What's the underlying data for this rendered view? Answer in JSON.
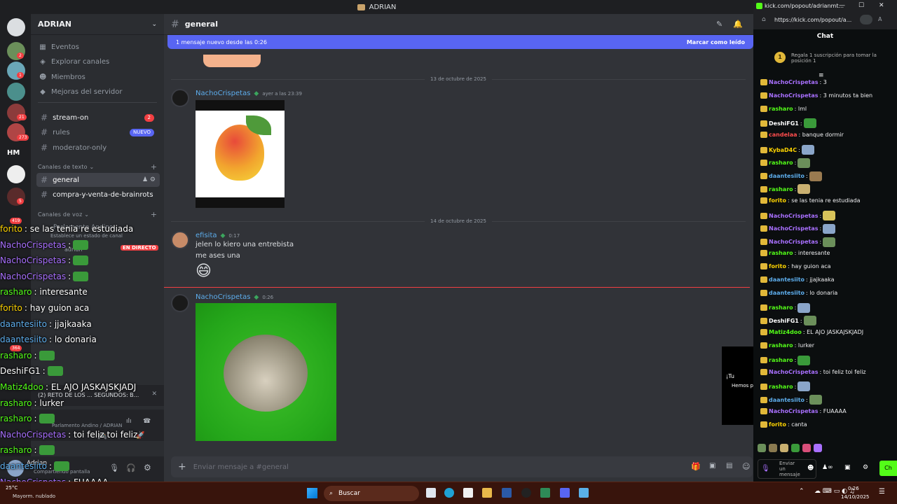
{
  "window": {
    "title": "ADRIAN"
  },
  "server": {
    "name": "ADRIAN"
  },
  "sidebar": {
    "menu": [
      {
        "label": "Eventos",
        "icon": "calendar-icon"
      },
      {
        "label": "Explorar canales",
        "icon": "compass-icon"
      },
      {
        "label": "Miembros",
        "icon": "members-icon"
      },
      {
        "label": "Mejoras del servidor",
        "icon": "boost-icon"
      }
    ],
    "top_channels": [
      {
        "name": "stream-on",
        "badge": "2"
      },
      {
        "name": "rules",
        "badge": "NUEVO"
      },
      {
        "name": "moderator-only",
        "badge": ""
      }
    ],
    "text_category": "Canales de texto",
    "text_channels": [
      {
        "name": "general"
      },
      {
        "name": "compra-y-venta-de-brainrots"
      }
    ],
    "voice_category": "Canales de voz",
    "voice_channel": "Parlamento Andino",
    "voice_status": "Establece un estado de canal",
    "live_badge": "EN DIRECTO",
    "voice_user": "adrian",
    "voice_connected": "Parlamento Andino / ADRIAN",
    "reto": "(2) RETO DE LOS ... SEGUNDOS: B...",
    "server_badges": [
      "2",
      "1",
      "21",
      "273",
      "HM",
      "5",
      "419",
      "364"
    ]
  },
  "user": {
    "name": "Adrian",
    "status": "Compartiendo pantalla"
  },
  "channel": {
    "name": "general",
    "new_banner": "1 mensaje nuevo desde las 0:26",
    "mark_read": "Marcar como leído",
    "composer_placeholder": "Enviar mensaje a #general"
  },
  "messages": [
    {
      "date": "13 de octubre de 2025"
    },
    {
      "author": "NachoCrispetas",
      "time": "ayer a las 23:39"
    },
    {
      "date": "14 de octubre de 2025"
    },
    {
      "author": "efisita",
      "time": "0:17",
      "lines": [
        "jelen lo kiero una entrebista",
        "me ases una"
      ],
      "emoji": "😄"
    },
    {
      "author": "NachoCrispetas",
      "time": "0:26"
    }
  ],
  "partial_popup": {
    "line1": "¡Tu",
    "line2": "Hemos p"
  },
  "kick": {
    "url_title": "kick.com/popout/adrianmt...",
    "url": "https://kick.com/popout/a...",
    "header": "Chat",
    "sub_rank": "1",
    "sub_promo": "Regala 1 suscripción para tomar la posición 1",
    "input_placeholder": "Enviar un mensaje",
    "send_label": "Ch",
    "messages": [
      {
        "user": "NachoCrispetas",
        "color": "#a970ff",
        "text": ": 3"
      },
      {
        "user": "NachoCrispetas",
        "color": "#a970ff",
        "text": ": 3 minutos ta bien"
      },
      {
        "user": "rasharo",
        "color": "#53fc18",
        "text": ": lml"
      },
      {
        "user": "DeshiFG1",
        "color": "#ffffff",
        "text": ":"
      },
      {
        "user": "candelaa",
        "color": "#ff4d4d",
        "text": ": banque dormir"
      },
      {
        "user": "KybaD4C",
        "color": "#ffd400",
        "text": ":"
      },
      {
        "user": "rasharo",
        "color": "#53fc18",
        "text": ":"
      },
      {
        "user": "daantesiito",
        "color": "#5dadec",
        "text": ":"
      },
      {
        "user": "rasharo",
        "color": "#53fc18",
        "text": ":"
      },
      {
        "user": "forito",
        "color": "#ffd400",
        "text": ": se las tenia re estudiada"
      },
      {
        "user": "NachoCrispetas",
        "color": "#a970ff",
        "text": ":"
      },
      {
        "user": "NachoCrispetas",
        "color": "#a970ff",
        "text": ":"
      },
      {
        "user": "NachoCrispetas",
        "color": "#a970ff",
        "text": ":"
      },
      {
        "user": "rasharo",
        "color": "#53fc18",
        "text": ": interesante"
      },
      {
        "user": "forito",
        "color": "#ffd400",
        "text": ": hay guion aca"
      },
      {
        "user": "daantesiito",
        "color": "#5dadec",
        "text": ": jjajkaaka"
      },
      {
        "user": "daantesiito",
        "color": "#5dadec",
        "text": ": lo donaria"
      },
      {
        "user": "rasharo",
        "color": "#53fc18",
        "text": ":"
      },
      {
        "user": "DeshiFG1",
        "color": "#ffffff",
        "text": ":"
      },
      {
        "user": "Matiz4doo",
        "color": "#53fc18",
        "text": ": EL AJO JASKAJSKJADJ"
      },
      {
        "user": "rasharo",
        "color": "#53fc18",
        "text": ": lurker"
      },
      {
        "user": "rasharo",
        "color": "#53fc18",
        "text": ":"
      },
      {
        "user": "NachoCrispetas",
        "color": "#a970ff",
        "text": ": toi feliz toi feliz"
      },
      {
        "user": "rasharo",
        "color": "#53fc18",
        "text": ":"
      },
      {
        "user": "daantesiito",
        "color": "#5dadec",
        "text": ":"
      },
      {
        "user": "NachoCrispetas",
        "color": "#a970ff",
        "text": ": FUAAAA"
      },
      {
        "user": "forito",
        "color": "#ffd400",
        "text": ": canta"
      }
    ]
  },
  "overlay": [
    {
      "user": "forito",
      "color": "#ffd400",
      "text": ": se las tenia re estudiada"
    },
    {
      "user": "NachoCrispetas",
      "color": "#a970ff",
      "text": ":"
    },
    {
      "user": "NachoCrispetas",
      "color": "#a970ff",
      "text": ":"
    },
    {
      "user": "NachoCrispetas",
      "color": "#a970ff",
      "text": ":"
    },
    {
      "user": "rasharo",
      "color": "#53fc18",
      "text": ": interesante"
    },
    {
      "user": "forito",
      "color": "#ffd400",
      "text": ": hay guion aca"
    },
    {
      "user": "daantesiito",
      "color": "#5dadec",
      "text": ": jjajkaaka"
    },
    {
      "user": "daantesiito",
      "color": "#5dadec",
      "text": ": lo donaria"
    },
    {
      "user": "rasharo",
      "color": "#53fc18",
      "text": ":"
    },
    {
      "user": "DeshiFG1",
      "color": "#ffffff",
      "text": ":"
    },
    {
      "user": "Matiz4doo",
      "color": "#53fc18",
      "text": ": EL AJO JASKAJSKJADJ"
    },
    {
      "user": "rasharo",
      "color": "#53fc18",
      "text": ": lurker"
    },
    {
      "user": "rasharo",
      "color": "#53fc18",
      "text": ":"
    },
    {
      "user": "NachoCrispetas",
      "color": "#a970ff",
      "text": ": toi feliz toi feliz"
    },
    {
      "user": "rasharo",
      "color": "#53fc18",
      "text": ":"
    },
    {
      "user": "daantesiito",
      "color": "#5dadec",
      "text": ":"
    },
    {
      "user": "NachoCrispetas",
      "color": "#a970ff",
      "text": ": FUAAAA"
    },
    {
      "user": "forito",
      "color": "#ffd400",
      "text": ": canta"
    }
  ],
  "taskbar": {
    "search": "Buscar",
    "weather": "25°C",
    "weather_desc": "Mayorm. nublado",
    "time": "0:26",
    "date": "14/10/2025"
  }
}
